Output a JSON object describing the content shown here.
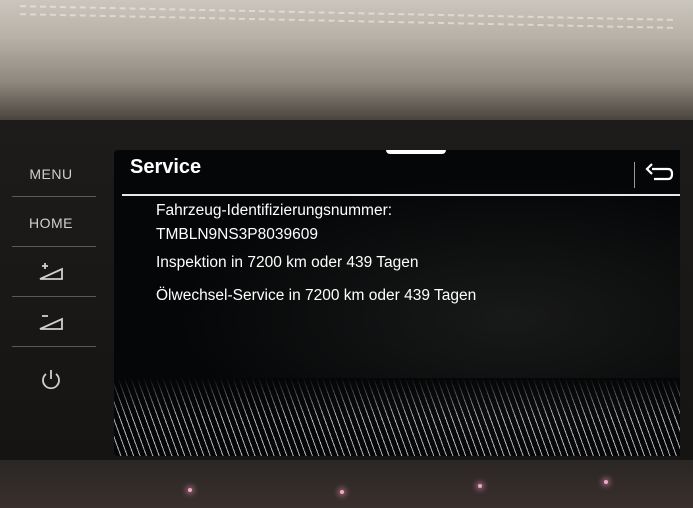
{
  "hardware_buttons": {
    "menu_label": "MENU",
    "home_label": "HOME",
    "volume_up_icon": "volume-up-icon",
    "volume_down_icon": "volume-down-icon",
    "power_icon": "power-icon"
  },
  "header": {
    "title": "Service",
    "back_icon": "back-arrow-icon"
  },
  "service_info": {
    "vin_label": "Fahrzeug-Identifizierungsnummer:",
    "vin_value": "TMBLN9NS3P8039609",
    "inspection": "Inspektion in 7200 km oder 439 Tagen",
    "oil_service": "Ölwechsel-Service in 7200 km oder 439 Tagen"
  },
  "colors": {
    "screen_bg": "#050607",
    "text": "#ffffff"
  }
}
